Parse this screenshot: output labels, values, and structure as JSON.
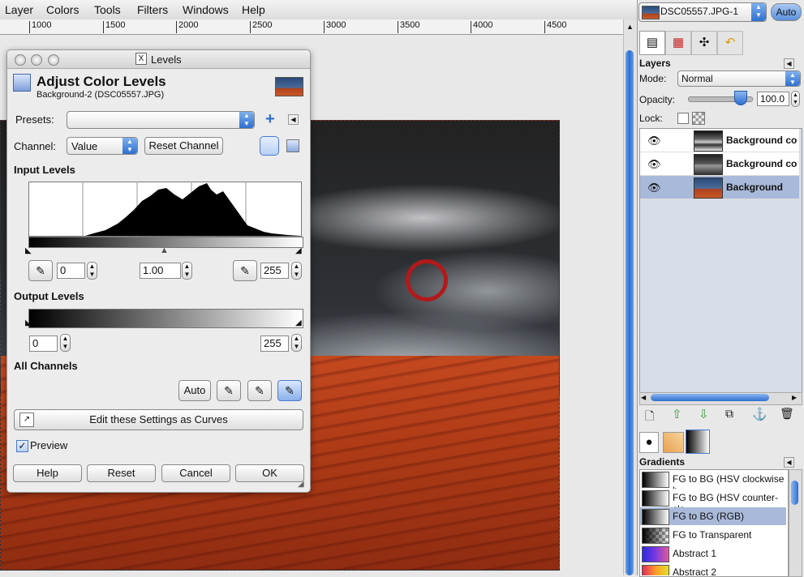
{
  "menu": [
    "Layer",
    "Colors",
    "Tools",
    "Filters",
    "Windows",
    "Help"
  ],
  "ruler_ticks": [
    "1000",
    "1500",
    "2000",
    "2500",
    "3000",
    "3500",
    "4000",
    "4500"
  ],
  "dialog": {
    "window_title": "Levels",
    "heading": "Adjust Color Levels",
    "subheading": "Background-2 (DSC05557.JPG)",
    "presets_label": "Presets:",
    "presets_value": "",
    "channel_label": "Channel:",
    "channel_value": "Value",
    "reset_channel": "Reset Channel",
    "input_levels_label": "Input Levels",
    "input_low": "0",
    "input_gamma": "1.00",
    "input_high": "255",
    "output_levels_label": "Output Levels",
    "output_low": "0",
    "output_high": "255",
    "all_channels_label": "All Channels",
    "auto_label": "Auto",
    "curves_label": "Edit these Settings as Curves",
    "preview_label": "Preview",
    "preview_checked": true,
    "help": "Help",
    "reset": "Reset",
    "cancel": "Cancel",
    "ok": "OK"
  },
  "dock": {
    "image_select": "DSC05557.JPG-1",
    "auto_button": "Auto",
    "layers_title": "Layers",
    "mode_label": "Mode:",
    "mode_value": "Normal",
    "opacity_label": "Opacity:",
    "opacity_value": "100.0",
    "lock_label": "Lock:",
    "layers": [
      {
        "name": "Background co",
        "selected": false
      },
      {
        "name": "Background co",
        "selected": false
      },
      {
        "name": "Background",
        "selected": true
      }
    ],
    "gradients_title": "Gradients",
    "gradients": [
      {
        "name": "FG to BG (HSV clockwise h",
        "selected": false
      },
      {
        "name": "FG to BG (HSV counter-clo",
        "selected": false
      },
      {
        "name": "FG to BG (RGB)",
        "selected": true
      },
      {
        "name": "FG to Transparent",
        "selected": false
      },
      {
        "name": "Abstract 1",
        "selected": false
      },
      {
        "name": "Abstract 2",
        "selected": false
      }
    ]
  },
  "colors": {
    "accent": "#2f6fd0",
    "selection": "#a9b9d9",
    "marker": "#b11a1a"
  }
}
